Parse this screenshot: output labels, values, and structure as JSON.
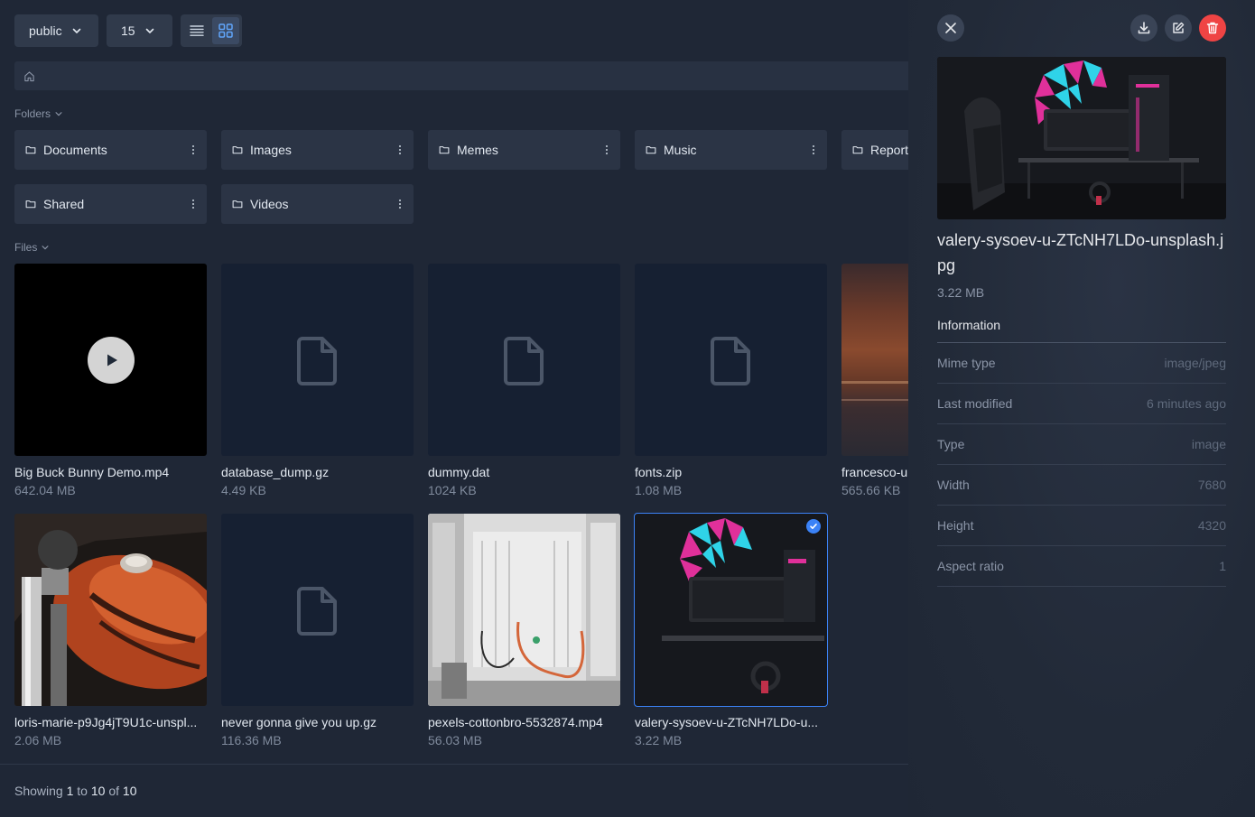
{
  "toolbar": {
    "disk": "public",
    "per_page": "15"
  },
  "sections": {
    "folders": "Folders",
    "files": "Files"
  },
  "folders": [
    {
      "name": "Documents"
    },
    {
      "name": "Images"
    },
    {
      "name": "Memes"
    },
    {
      "name": "Music"
    },
    {
      "name": "Report"
    },
    {
      "name": "Shared"
    },
    {
      "name": "Videos"
    }
  ],
  "files": [
    {
      "name": "Big Buck Bunny Demo.mp4",
      "size": "642.04 MB",
      "kind": "video"
    },
    {
      "name": "database_dump.gz",
      "size": "4.49 KB",
      "kind": "generic"
    },
    {
      "name": "dummy.dat",
      "size": "1024 KB",
      "kind": "generic"
    },
    {
      "name": "fonts.zip",
      "size": "1.08 MB",
      "kind": "generic"
    },
    {
      "name": "francesco-u",
      "size": "565.66 KB",
      "kind": "image"
    },
    {
      "name": "loris-marie-p9Jg4jT9U1c-unspl...",
      "size": "2.06 MB",
      "kind": "image"
    },
    {
      "name": "never gonna give you up.gz",
      "size": "116.36 MB",
      "kind": "generic"
    },
    {
      "name": "pexels-cottonbro-5532874.mp4",
      "size": "56.03 MB",
      "kind": "video"
    },
    {
      "name": "valery-sysoev-u-ZTcNH7LDo-u...",
      "size": "3.22 MB",
      "kind": "image",
      "selected": true
    }
  ],
  "footer": {
    "showing": "Showing",
    "from": "1",
    "to_word": "to",
    "to": "10",
    "of_word": "of",
    "total": "10"
  },
  "details": {
    "title": "valery-sysoev-u-ZTcNH7LDo-unsplash.jpg",
    "size": "3.22 MB",
    "info_heading": "Information",
    "rows": [
      {
        "label": "Mime type",
        "value": "image/jpeg"
      },
      {
        "label": "Last modified",
        "value": "6 minutes ago"
      },
      {
        "label": "Type",
        "value": "image"
      },
      {
        "label": "Width",
        "value": "7680"
      },
      {
        "label": "Height",
        "value": "4320"
      },
      {
        "label": "Aspect ratio",
        "value": "1"
      }
    ]
  },
  "colors": {
    "accent": "#3b82f6",
    "danger": "#ef4444"
  }
}
